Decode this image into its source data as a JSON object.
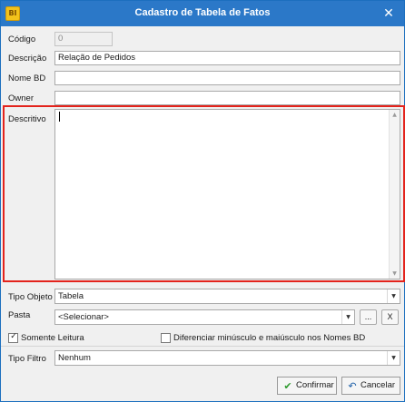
{
  "window": {
    "app_icon_text": "BI",
    "title": "Cadastro de Tabela de Fatos",
    "close_glyph": "✕",
    "accent_color": "#2b78c8",
    "highlight_color": "#e3231c"
  },
  "form": {
    "codigo": {
      "label": "Código",
      "value": "0"
    },
    "descricao": {
      "label": "Descrição",
      "value": "Relação de Pedidos"
    },
    "nome_bd": {
      "label": "Nome BD",
      "value": ""
    },
    "owner": {
      "label": "Owner",
      "value": ""
    },
    "descritivo": {
      "label": "Descritivo",
      "value": ""
    },
    "tipo_objeto": {
      "label": "Tipo Objeto",
      "value": "Tabela"
    },
    "pasta": {
      "label": "Pasta",
      "value": "<Selecionar>",
      "browse_label": "...",
      "clear_label": "X"
    },
    "somente_leitura": {
      "label": "Somente Leitura",
      "checked": true
    },
    "diferenciar": {
      "label": "Diferenciar minúsculo e maiúsculo nos Nomes BD",
      "checked": false
    },
    "tipo_filtro": {
      "label": "Tipo Filtro",
      "value": "Nenhum"
    }
  },
  "footer": {
    "confirm_label": "Confirmar",
    "confirm_icon": "check-icon",
    "cancel_label": "Cancelar",
    "cancel_icon": "undo-icon"
  }
}
